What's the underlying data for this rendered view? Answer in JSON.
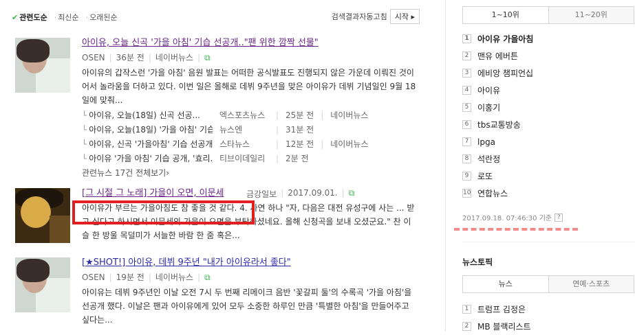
{
  "sort": {
    "relevance": "관련도순",
    "latest": "최신순",
    "oldest": "오래된순"
  },
  "auto": {
    "label": "검색결과자동고침",
    "button": "시작"
  },
  "articles": [
    {
      "title": "아이유, 오늘 신곡 '가을 아침' 기습 선공개..\"팬 위한 깜짝 선물\"",
      "source": "OSEN",
      "time": "36분 전",
      "via": "네이버뉴스",
      "desc": "아이유의 갑작스런 '가을 아침' 음원 발표는 어떠한 공식발표도 진행되지 않은 가운데 이뤄진 것이어서 놀라움을 더하고 있다.   이번 일은 올해로 데뷔 9주년을 맞은 아이유가 데뷔 기념일인 9월 18일에 맞춰...",
      "related": [
        {
          "title": "아이유, 오늘(18일) 신곡 선공...",
          "source": "엑스포츠뉴스",
          "time": "25분 전",
          "via": "네이버뉴스"
        },
        {
          "title": "아이유, 오늘(18일) '가을 아침' 기습...",
          "source": "뉴스엔",
          "time": "31분 전",
          "via": ""
        },
        {
          "title": "아이유, 신곡 '가을아침' 기습 선공개...",
          "source": "스타뉴스",
          "time": "12분 전",
          "via": "네이버뉴스"
        },
        {
          "title": "아이유 '가을 아침' 기습 공개, '효리...",
          "source": "티브이데일리",
          "time": "2분 전",
          "via": ""
        }
      ],
      "more": "관련뉴스 17건 전체보기›"
    },
    {
      "title": "[그 시절 그 노래] 가을이 오면, 이문세",
      "source": "금강일보",
      "time": "2017.09.01.",
      "via": "",
      "desc": "아이유가 부르는 가을아침도 참 좋을 것 같다.  4. 사연 하나 \"자, 다음은 대전 유성구에 사는 ... 받고 싶다고 하시면서 이문세의 가을이 오면을 부탁하셨네요. 올해 신청곡을 보내 오셨군요.\" 찬 이슬 한 방울 목덜미가 서늘한 바람 한 줌 혹은..."
    },
    {
      "title": "[★SHOT!] 아이유, 데뷔 9주년 \"내가 아이유라서 좋다\"",
      "source": "OSEN",
      "time": "19분 전",
      "via": "네이버뉴스",
      "desc": "아이유는 데뷔 9주년인 이날 오전 7시 두 번째 리메이크 음반 '꽃갈피 둘'의 수록곡 '가을 아침'을 선공개 했다. 이날은 팬과 아이유에게 있어 모두 소중한 하루인 만큼 '특별한 아침'을 만들어주고 싶다는..."
    }
  ],
  "side": {
    "tab_active": "1~10위",
    "tab_other": "11~20위",
    "ranks": [
      "아이유 가을아침",
      "맨유 에버튼",
      "에비앙 챔피언십",
      "아이유",
      "이홍기",
      "tbs교통방송",
      "lpga",
      "석란정",
      "로또",
      "연합뉴스"
    ],
    "timestamp": "2017.09.18.  07:46:30 기준",
    "help": "?",
    "topic_title": "뉴스토픽",
    "topic_tab_active": "뉴스",
    "topic_tab_other": "연예·스포츠",
    "topics": [
      "트럼프 김정은",
      "MB 블랙리스트"
    ]
  }
}
